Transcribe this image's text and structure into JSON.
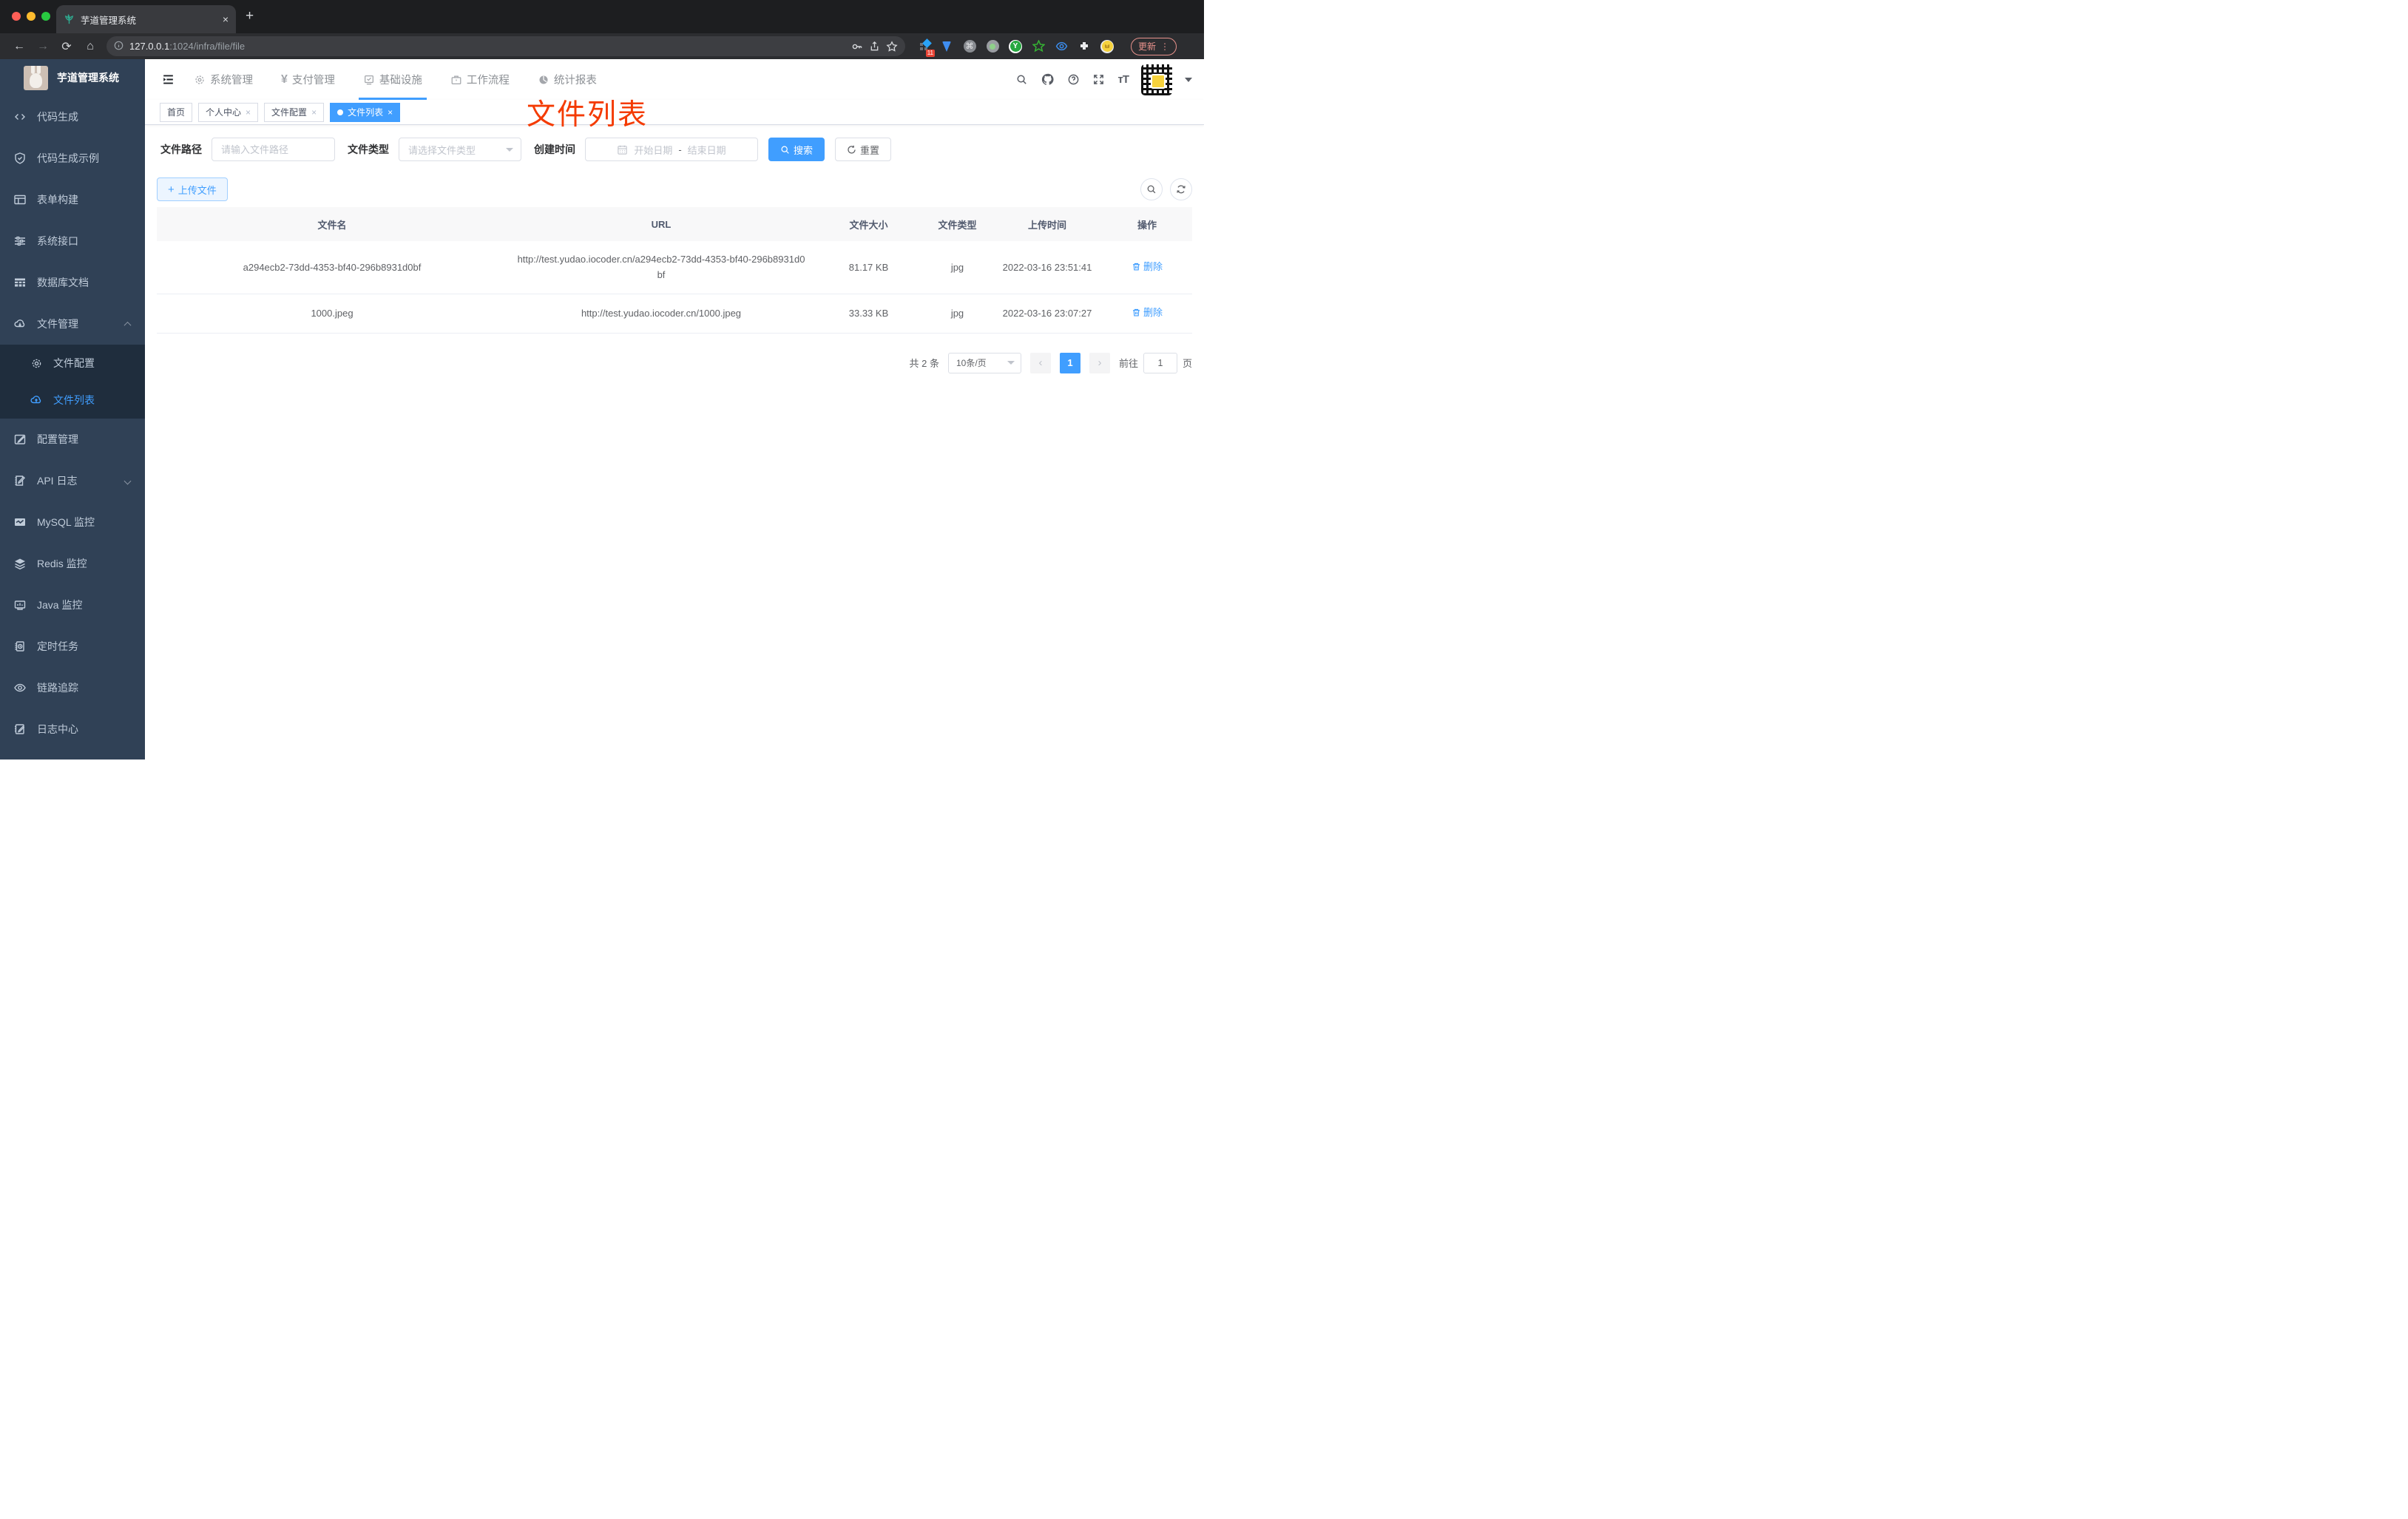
{
  "browser": {
    "tab_title": "芋道管理系统",
    "close_tab": "×",
    "new_tab": "+",
    "back": "←",
    "forward": "→",
    "reload": "⟳",
    "home": "⌂",
    "url_host": "127.0.0.1",
    "url_rest": ":1024/infra/file/file",
    "ext_badge": "11",
    "update_label": "更新",
    "menu_dots": "⋮"
  },
  "sidebar": {
    "title": "芋道管理系统",
    "items": [
      {
        "label": "代码生成",
        "icon": "code-icon"
      },
      {
        "label": "代码生成示例",
        "icon": "shield-check-icon"
      },
      {
        "label": "表单构建",
        "icon": "form-icon"
      },
      {
        "label": "系统接口",
        "icon": "sliders-icon"
      },
      {
        "label": "数据库文档",
        "icon": "grid-icon"
      },
      {
        "label": "文件管理",
        "icon": "cloud-download-icon"
      },
      {
        "label": "文件配置",
        "icon": "gear-icon"
      },
      {
        "label": "文件列表",
        "icon": "cloud-upload-icon"
      },
      {
        "label": "配置管理",
        "icon": "edit-icon"
      },
      {
        "label": "API 日志",
        "icon": "doc-edit-icon"
      },
      {
        "label": "MySQL 监控",
        "icon": "chart-monitor-icon"
      },
      {
        "label": "Redis 监控",
        "icon": "layers-icon"
      },
      {
        "label": "Java 监控",
        "icon": "monitor-icon"
      },
      {
        "label": "定时任务",
        "icon": "schedule-icon"
      },
      {
        "label": "链路追踪",
        "icon": "eye-icon"
      },
      {
        "label": "日志中心",
        "icon": "note-edit-icon"
      }
    ]
  },
  "topnav": {
    "items": [
      {
        "label": "系统管理"
      },
      {
        "label": "支付管理"
      },
      {
        "label": "基础设施"
      },
      {
        "label": "工作流程"
      },
      {
        "label": "统计报表"
      }
    ],
    "yen": "¥"
  },
  "tags": {
    "close": "×",
    "items": [
      {
        "label": "首页"
      },
      {
        "label": "个人中心"
      },
      {
        "label": "文件配置"
      },
      {
        "label": "文件列表"
      }
    ]
  },
  "annotation": {
    "text": "文件列表",
    "color": "#f43b02"
  },
  "filters": {
    "path_label": "文件路径",
    "path_placeholder": "请输入文件路径",
    "type_label": "文件类型",
    "type_placeholder": "请选择文件类型",
    "date_label": "创建时间",
    "date_start": "开始日期",
    "date_separator": "-",
    "date_end": "结束日期",
    "search_label": "搜索",
    "reset_label": "重置"
  },
  "toolbar": {
    "upload_label": "上传文件",
    "plus": "+"
  },
  "table": {
    "columns": [
      "文件名",
      "URL",
      "文件大小",
      "文件类型",
      "上传时间",
      "操作"
    ],
    "rows": [
      {
        "name": "a294ecb2-73dd-4353-bf40-296b8931d0bf",
        "url": "http://test.yudao.iocoder.cn/a294ecb2-73dd-4353-bf40-296b8931d0bf",
        "size": "81.17 KB",
        "type": "jpg",
        "time": "2022-03-16 23:51:41",
        "action": "删除"
      },
      {
        "name": "1000.jpeg",
        "url": "http://test.yudao.iocoder.cn/1000.jpeg",
        "size": "33.33 KB",
        "type": "jpg",
        "time": "2022-03-16 23:07:27",
        "action": "删除"
      }
    ]
  },
  "pagination": {
    "total": "共 2 条",
    "page_size": "10条/页",
    "prev": "‹",
    "current": "1",
    "next": "›",
    "goto_label": "前往",
    "goto_value": "1",
    "unit": "页"
  },
  "colors": {
    "accent": "#409eff",
    "annotation_red": "#f43b02",
    "sidebar_bg": "#304156",
    "submenu_bg": "#1f2d3d"
  }
}
